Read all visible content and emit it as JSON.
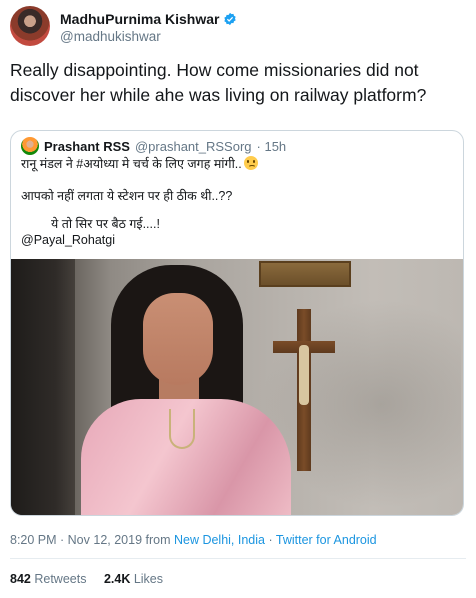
{
  "author": {
    "name": "MadhuPurnima Kishwar",
    "handle": "@madhukishwar",
    "avatar_icon": "profile-avatar",
    "verified_icon": "verified-badge-icon",
    "verified_color": "#1da1f2"
  },
  "tweet": {
    "text": "Really disappointing. How come missionaries did not discover her while ahe was living on railway platform?"
  },
  "quoted": {
    "name": "Prashant RSS",
    "handle": "@prashant_RSSorg",
    "time": "· 15h",
    "line1": "रानू मंडल ने #अयोध्या मे चर्च के लिए जगह मांगी..",
    "line1_emoji": "worried-face-emoji",
    "line2": "आपको नहीं लगता ये स्टेशन पर ही ठीक थी..??",
    "line3": "ये तो सिर पर बैठ गई....!",
    "mention": "@Payal_Rohatgi"
  },
  "meta": {
    "time": "8:20 PM · Nov 12, 2019 from ",
    "location": "New Delhi, India",
    "sep": " · ",
    "source": "Twitter for Android",
    "link_color": "#1b95e0"
  },
  "stats": {
    "retweets_count": "842",
    "retweets_label": "Retweets",
    "likes_count": "2.4K",
    "likes_label": "Likes"
  }
}
